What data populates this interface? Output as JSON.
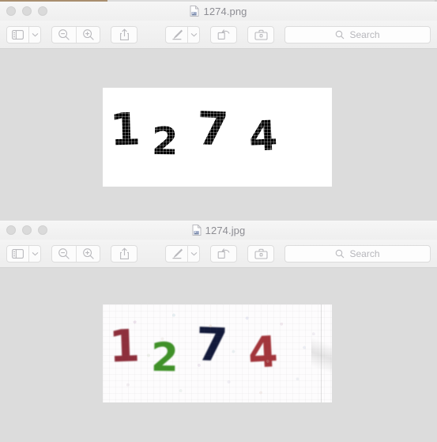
{
  "windows": [
    {
      "title": "1274.png",
      "title_icon": "image-document-icon",
      "traffic_lights": [
        "close-button",
        "minimize-button",
        "zoom-button"
      ],
      "toolbar": {
        "sidebar_label": "Sidebar",
        "sidebar_menu_label": "Sidebar options",
        "zoom_out_label": "Zoom Out",
        "zoom_in_label": "Zoom In",
        "share_label": "Share",
        "markup_label": "Markup",
        "markup_menu_label": "Markup options",
        "rotate_label": "Rotate Left",
        "toolkit_label": "Adjust Size",
        "search_placeholder": "Search"
      },
      "image": {
        "format": "PNG",
        "digits": [
          {
            "char": "1",
            "color": "#000000"
          },
          {
            "char": "2",
            "color": "#000000"
          },
          {
            "char": "7",
            "color": "#000000"
          },
          {
            "char": "4",
            "color": "#000000"
          }
        ],
        "background": "#ffffff"
      }
    },
    {
      "title": "1274.jpg",
      "title_icon": "image-document-icon",
      "traffic_lights": [
        "close-button",
        "minimize-button",
        "zoom-button"
      ],
      "toolbar": {
        "sidebar_label": "Sidebar",
        "sidebar_menu_label": "Sidebar options",
        "zoom_out_label": "Zoom Out",
        "zoom_in_label": "Zoom In",
        "share_label": "Share",
        "markup_label": "Markup",
        "markup_menu_label": "Markup options",
        "rotate_label": "Rotate Left",
        "toolkit_label": "Adjust Size",
        "search_placeholder": "Search"
      },
      "image": {
        "format": "JPEG",
        "digits": [
          {
            "char": "1",
            "color": "#8e2f3c"
          },
          {
            "char": "2",
            "color": "#3f9128"
          },
          {
            "char": "7",
            "color": "#12193a"
          },
          {
            "char": "4",
            "color": "#a3353b"
          }
        ],
        "background": "#fdfcfd"
      }
    }
  ],
  "desktop": {
    "background": "#dcdcdc",
    "accent_strip_color": "#a98f6f"
  }
}
